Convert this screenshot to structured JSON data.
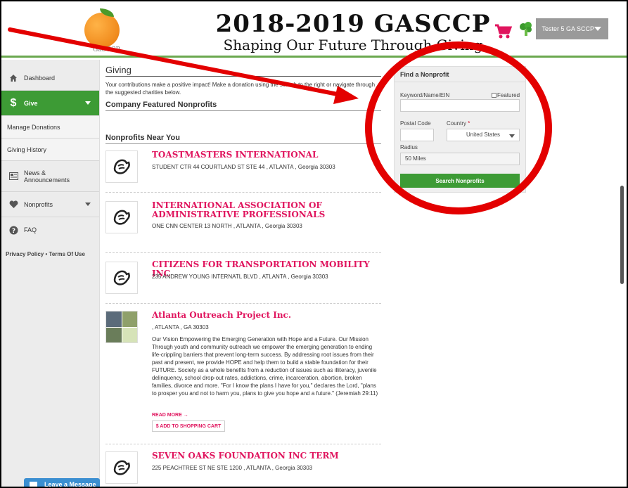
{
  "header": {
    "title": "2018-2019 GASCCP",
    "subtitle": "Shaping Our Future Through Giving",
    "logo_text": "GaSCCP",
    "user_name": "Tester 5 GA SCCP",
    "icons": [
      "shopping-cart-icon",
      "broccoli-avatar-icon",
      "chevron-down-icon"
    ]
  },
  "sidebar": {
    "items": [
      {
        "label": "Dashboard",
        "icon": "home-icon"
      },
      {
        "label": "Give",
        "icon": "dollar-icon",
        "active": true
      },
      {
        "label": "Manage Donations"
      },
      {
        "label": "Giving History"
      },
      {
        "label": "News & Announcements",
        "icon": "news-icon"
      },
      {
        "label": "Nonprofits",
        "icon": "heart-icon"
      },
      {
        "label": "FAQ",
        "icon": "question-icon"
      }
    ],
    "privacy": "Privacy Policy",
    "terms": "Terms Of Use",
    "leave_message": "Leave a Message"
  },
  "main": {
    "title": "Giving",
    "intro": "Your contributions make a positive impact! Make a donation using the search to the right or navigate through the suggested charities below.",
    "featured_title": "Company Featured Nonprofits",
    "near_title": "Nonprofits Near You",
    "orgs": [
      {
        "name": "TOASTMASTERS INTERNATIONAL",
        "address": "STUDENT CTR 44 COURTLAND ST STE 44 , ATLANTA , Georgia 30303"
      },
      {
        "name": "INTERNATIONAL ASSOCIATION OF ADMINISTRATIVE PROFESSIONALS",
        "address": "ONE CNN CENTER 13 NORTH , ATLANTA , Georgia 30303"
      },
      {
        "name": "CITIZENS FOR TRANSPORTATION MOBILITY INC",
        "address": "235 ANDREW YOUNG INTERNATL BLVD , ATLANTA , Georgia 30303"
      },
      {
        "name": "Atlanta Outreach Project Inc.",
        "address": ", ATLANTA , GA 30303",
        "description": "Our Vision Empowering the Emerging Generation with Hope and a Future. Our Mission Through youth and community outreach we empower the emerging generation to ending life-crippling barriers that prevent long-term success. By addressing root issues from their past and present, we provide HOPE and help them to build a stable foundation for their FUTURE. Society as a whole benefits from a reduction of issues such as illiteracy, juvenile delinquency, school drop-out rates, addictions, crime, incarceration, abortion, broken families, divorce and more. \"For I know the plans I have for you,\" declares the Lord, \"plans to prosper you and not to harm you, plans to give you hope and a future.\" (Jeremiah 29:11)",
        "read_more": "READ MORE →",
        "add_to_cart": "$ ADD TO SHOPPING CART"
      },
      {
        "name": "SEVEN OAKS FOUNDATION INC TERM",
        "address": "225 PEACHTREE ST NE STE 1200 , ATLANTA , Georgia 30303"
      }
    ]
  },
  "find": {
    "title": "Find a Nonprofit",
    "keyword_label": "Keyword/Name/EIN",
    "featured_label": "Featured",
    "postal_label": "Postal Code",
    "country_label": "Country",
    "country_required": "*",
    "country_value": "United States",
    "radius_label": "Radius",
    "radius_value": "50 Miles",
    "search_button": "Search Nonprofits"
  },
  "colors": {
    "brand_green": "#3d9b35",
    "org_pink": "#e0155e",
    "annotation_red": "#e30000"
  }
}
